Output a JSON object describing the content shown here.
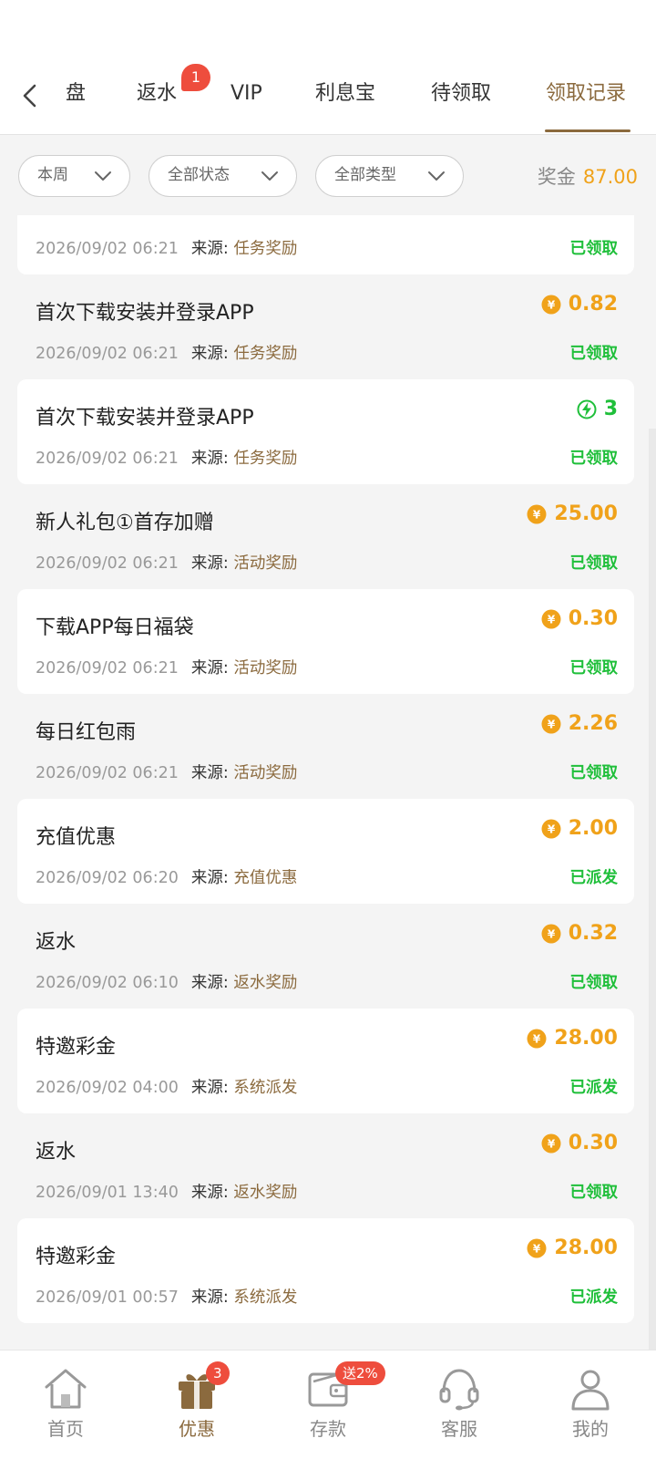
{
  "tabs": [
    {
      "label": "盘"
    },
    {
      "label": "返水",
      "badge": "1"
    },
    {
      "label": "VIP"
    },
    {
      "label": "利息宝"
    },
    {
      "label": "待领取"
    },
    {
      "label": "领取记录",
      "active": true
    }
  ],
  "filters": {
    "period": "本周",
    "status": "全部状态",
    "type": "全部类型"
  },
  "bonus": {
    "label": "奖金",
    "value": "87.00"
  },
  "source_label": "来源:",
  "records": [
    {
      "title": "",
      "time": "2026/09/02 06:21",
      "source": "任务奖励",
      "amount": "",
      "status": "已领取",
      "white": true
    },
    {
      "title": "首次下载安装并登录APP",
      "time": "2026/09/02 06:21",
      "source": "任务奖励",
      "amount": "0.82",
      "status": "已领取",
      "white": false,
      "icon": "coin"
    },
    {
      "title": "首次下载安装并登录APP",
      "time": "2026/09/02 06:21",
      "source": "任务奖励",
      "amount": "3",
      "status": "已领取",
      "white": true,
      "icon": "bolt"
    },
    {
      "title": "新人礼包①首存加赠",
      "time": "2026/09/02 06:21",
      "source": "活动奖励",
      "amount": "25.00",
      "status": "已领取",
      "white": false,
      "icon": "coin"
    },
    {
      "title": "下载APP每日福袋",
      "time": "2026/09/02 06:21",
      "source": "活动奖励",
      "amount": "0.30",
      "status": "已领取",
      "white": true,
      "icon": "coin"
    },
    {
      "title": "每日红包雨",
      "time": "2026/09/02 06:21",
      "source": "活动奖励",
      "amount": "2.26",
      "status": "已领取",
      "white": false,
      "icon": "coin"
    },
    {
      "title": "充值优惠",
      "time": "2026/09/02 06:20",
      "source": "充值优惠",
      "amount": "2.00",
      "status": "已派发",
      "white": true,
      "icon": "coin"
    },
    {
      "title": "返水",
      "time": "2026/09/02 06:10",
      "source": "返水奖励",
      "amount": "0.32",
      "status": "已领取",
      "white": false,
      "icon": "coin"
    },
    {
      "title": "特邀彩金",
      "time": "2026/09/02 04:00",
      "source": "系统派发",
      "amount": "28.00",
      "status": "已派发",
      "white": true,
      "icon": "coin"
    },
    {
      "title": "返水",
      "time": "2026/09/01 13:40",
      "source": "返水奖励",
      "amount": "0.30",
      "status": "已领取",
      "white": false,
      "icon": "coin"
    },
    {
      "title": "特邀彩金",
      "time": "2026/09/01 00:57",
      "source": "系统派发",
      "amount": "28.00",
      "status": "已派发",
      "white": true,
      "icon": "coin"
    }
  ],
  "bottom_nav": [
    {
      "label": "首页",
      "icon": "home-icon"
    },
    {
      "label": "优惠",
      "icon": "gift-icon",
      "badge": "3",
      "active": true
    },
    {
      "label": "存款",
      "icon": "wallet-icon",
      "badge": "送2%"
    },
    {
      "label": "客服",
      "icon": "headset-icon"
    },
    {
      "label": "我的",
      "icon": "user-icon"
    }
  ],
  "colors": {
    "accent": "#8b6a3e",
    "amount": "#f0a21a",
    "status": "#1fbf3a",
    "badge": "#ee4d3d"
  }
}
